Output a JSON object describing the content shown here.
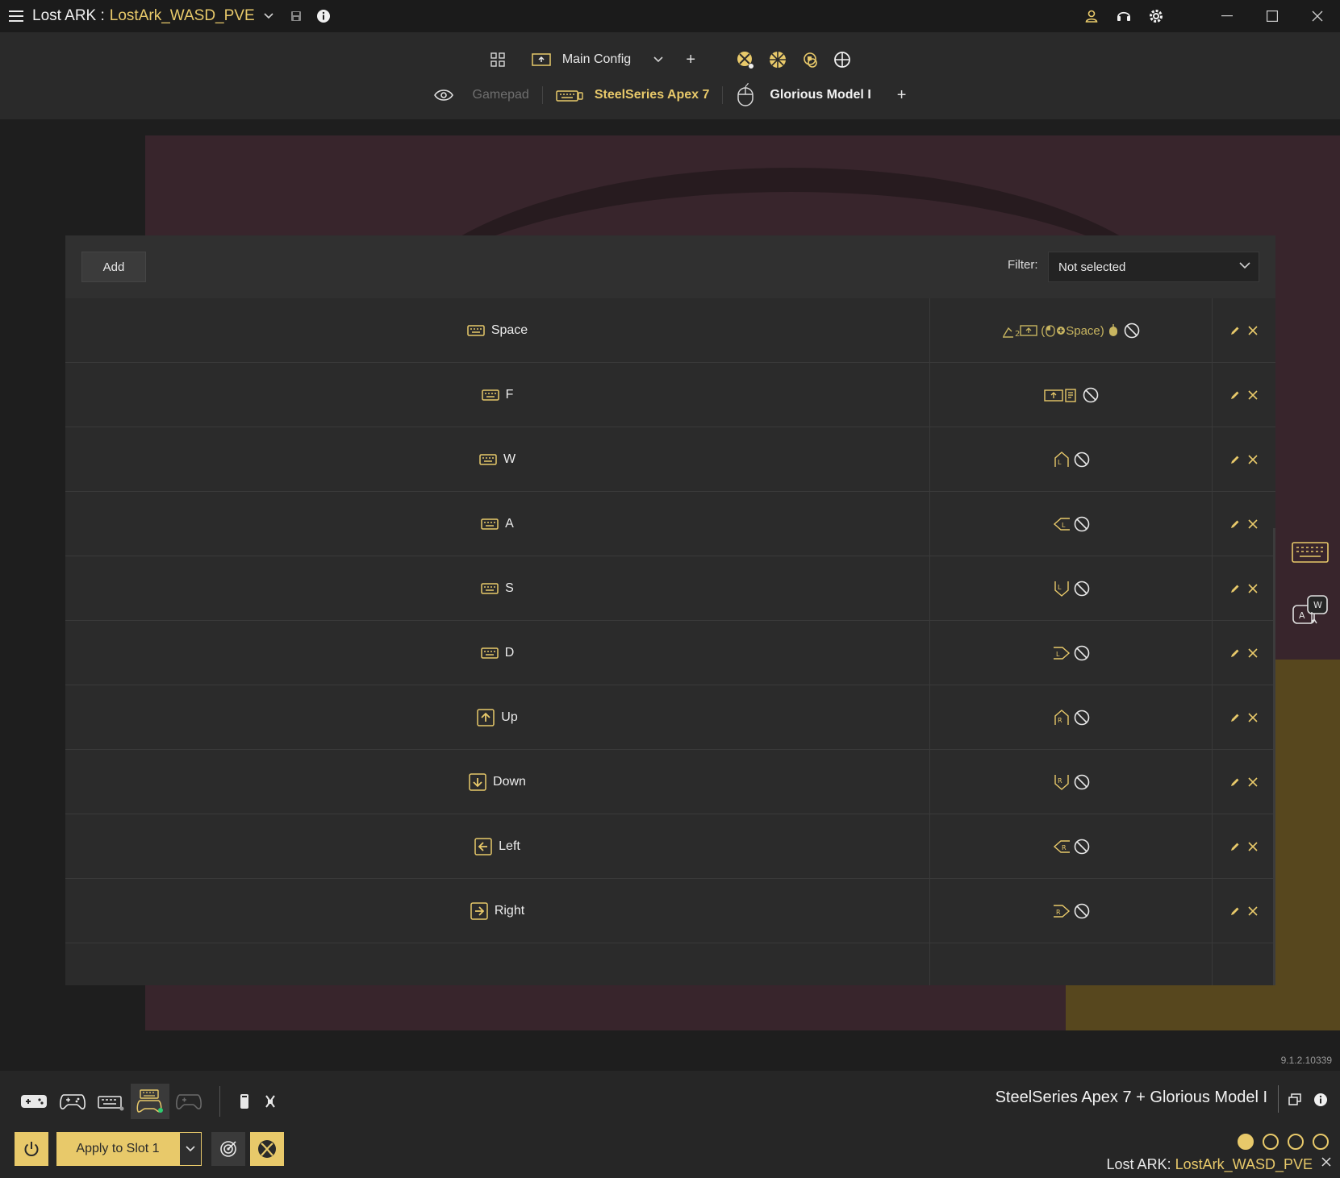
{
  "titlebar": {
    "game": "Lost ARK :",
    "profile": "LostArk_WASD_PVE",
    "icons": [
      "menu-icon",
      "chevron-down-icon",
      "save-icon",
      "info-icon",
      "user-icon",
      "headset-icon",
      "gear-icon",
      "minimize-icon",
      "maximize-icon",
      "close-icon"
    ]
  },
  "toolbar": {
    "config_name": "Main Config",
    "add_label": "+",
    "device_tabs": [
      {
        "label": "Gamepad",
        "state": "inactive"
      },
      {
        "label": "SteelSeries Apex 7",
        "state": "active"
      },
      {
        "label": "Glorious Model I",
        "state": "active"
      }
    ],
    "add_device": "+"
  },
  "panel": {
    "add_label": "Add",
    "filter_label": "Filter:",
    "filter_value": "Not selected",
    "rows": [
      {
        "key": "Space",
        "icon": "keyboard-icon",
        "mapping_text": "Space",
        "mapping": "macro"
      },
      {
        "key": "F",
        "icon": "keyboard-icon",
        "mapping": "shift-layer"
      },
      {
        "key": "W",
        "icon": "keyboard-icon",
        "mapping": "left-stick-up"
      },
      {
        "key": "A",
        "icon": "keyboard-icon",
        "mapping": "left-stick-left"
      },
      {
        "key": "S",
        "icon": "keyboard-icon",
        "mapping": "left-stick-down"
      },
      {
        "key": "D",
        "icon": "keyboard-icon",
        "mapping": "left-stick-right"
      },
      {
        "key": "Up",
        "icon": "arrow-up-icon",
        "mapping": "right-stick-up"
      },
      {
        "key": "Down",
        "icon": "arrow-down-icon",
        "mapping": "right-stick-down"
      },
      {
        "key": "Left",
        "icon": "arrow-left-icon",
        "mapping": "right-stick-left"
      },
      {
        "key": "Right",
        "icon": "arrow-right-icon",
        "mapping": "right-stick-right"
      }
    ]
  },
  "version": "9.1.2.10339",
  "bottom": {
    "apply_label": "Apply to Slot 1",
    "active_devices": "SteelSeries Apex 7 + Glorious Model I",
    "profile_game": "Lost ARK:",
    "profile_name": "LostArk_WASD_PVE",
    "slots": [
      true,
      false,
      false,
      false
    ]
  },
  "colors": {
    "accent": "#e8c96a",
    "background": "#1f1f1f",
    "panel": "#2b2b2b",
    "mapping_green": "#c8b560"
  }
}
